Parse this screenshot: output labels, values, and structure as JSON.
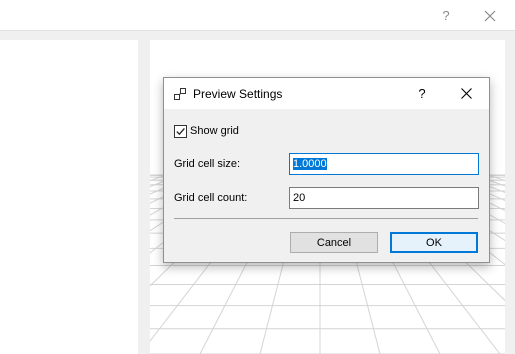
{
  "parent_window": {
    "help_glyph": "?",
    "close_icon": "close-icon"
  },
  "dialog": {
    "title": "Preview Settings",
    "help_glyph": "?",
    "title_icon": "preview-settings-icon",
    "show_grid": {
      "label": "Show grid",
      "checked": true
    },
    "grid_cell_size": {
      "label": "Grid cell size:",
      "value": "1.0000"
    },
    "grid_cell_count": {
      "label": "Grid cell count:",
      "value": "20"
    },
    "cancel_label": "Cancel",
    "ok_label": "OK"
  },
  "colors": {
    "accent": "#0078d7",
    "dialog_bg": "#f0f0f0",
    "grid_line": "#d4d4d4"
  }
}
